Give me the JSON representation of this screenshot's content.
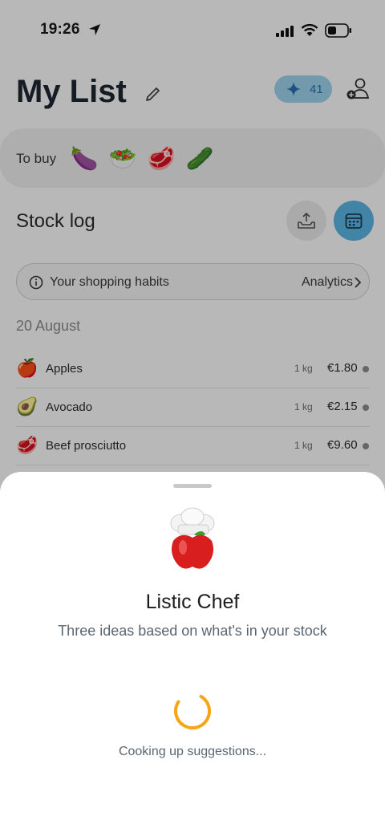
{
  "status_bar": {
    "time": "19:26",
    "icons": [
      "location-arrow-icon",
      "signal-icon",
      "wifi-icon",
      "battery-icon"
    ]
  },
  "header": {
    "title": "My List",
    "credits_count": "41",
    "icons": [
      "edit-pencil-icon",
      "sparkle-icon",
      "add-user-icon"
    ]
  },
  "to_buy": {
    "label": "To buy",
    "items": [
      "🍆",
      "🥗",
      "🥩",
      "🥒"
    ]
  },
  "stock_log": {
    "title": "Stock log",
    "habits_label": "Your shopping habits",
    "analytics_label": "Analytics",
    "date": "20 August",
    "items": [
      {
        "emoji": "🍎",
        "name": "Apples",
        "qty": "1 kg",
        "price": "€1.80"
      },
      {
        "emoji": "🥑",
        "name": "Avocado",
        "qty": "1 kg",
        "price": "€2.15"
      },
      {
        "emoji": "🥩",
        "name": "Beef prosciutto",
        "qty": "1 kg",
        "price": "€9.60"
      }
    ]
  },
  "sheet": {
    "title": "Listic Chef",
    "subtitle": "Three ideas based on what's in your stock",
    "loading_text": "Cooking up suggestions..."
  },
  "colors": {
    "accent_blue": "#5cb8e6",
    "badge_blue": "#9fd6ef",
    "spinner_orange": "#f5a516",
    "text_muted": "#5b6670"
  }
}
